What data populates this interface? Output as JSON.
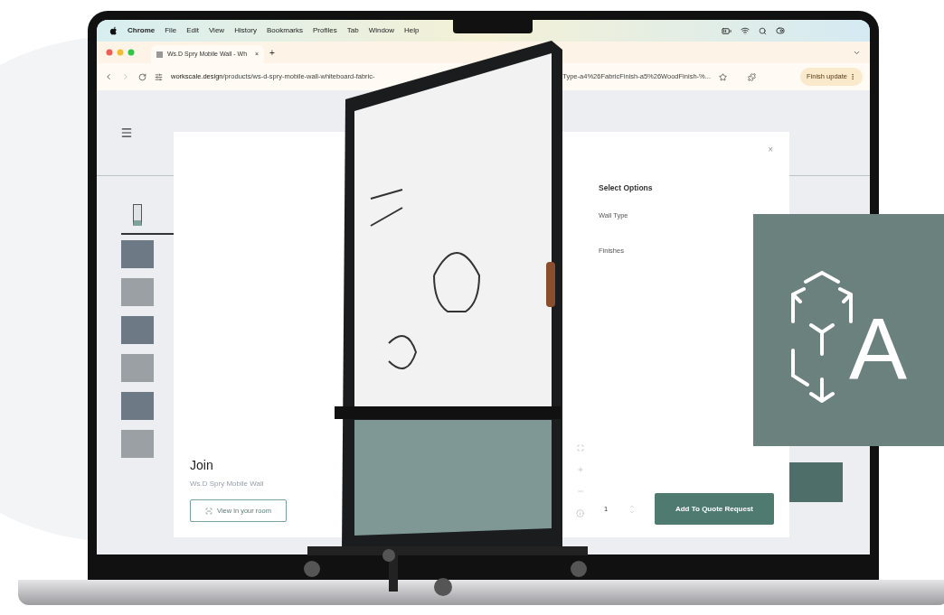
{
  "menubar": {
    "app": "Chrome",
    "items": [
      "File",
      "Edit",
      "View",
      "History",
      "Bookmarks",
      "Profiles",
      "Tab",
      "Window",
      "Help"
    ]
  },
  "tab": {
    "title": "Ws.D Spry Mobile Wall - Wh",
    "close": "×",
    "new_tab": "+"
  },
  "address_bar": {
    "domain": "workscale.design",
    "path": "/products/ws-d-spry-mobile-wall-whiteboard-fabric-",
    "path_end": "Type-a4%26FabricFinish-a5%26WoodFinish-%...",
    "update_button": "Finish update"
  },
  "thumbnails": [
    {
      "kind": "product",
      "selected": true
    },
    {
      "kind": "photo",
      "selected": false
    },
    {
      "kind": "photo",
      "selected": false
    },
    {
      "kind": "photo",
      "selected": false
    },
    {
      "kind": "photo",
      "selected": false
    },
    {
      "kind": "photo",
      "selected": false
    },
    {
      "kind": "photo",
      "selected": false
    }
  ],
  "modal": {
    "close": "×",
    "title": "Join",
    "subtitle": "Ws.D Spry Mobile Wall",
    "ar_button": "View in your room",
    "options": {
      "heading": "Select Options",
      "items": [
        "Wall Type",
        "Finishes"
      ]
    },
    "quantity": "1",
    "add_button": "Add To Quote Request"
  },
  "badge": {
    "text": "A"
  }
}
